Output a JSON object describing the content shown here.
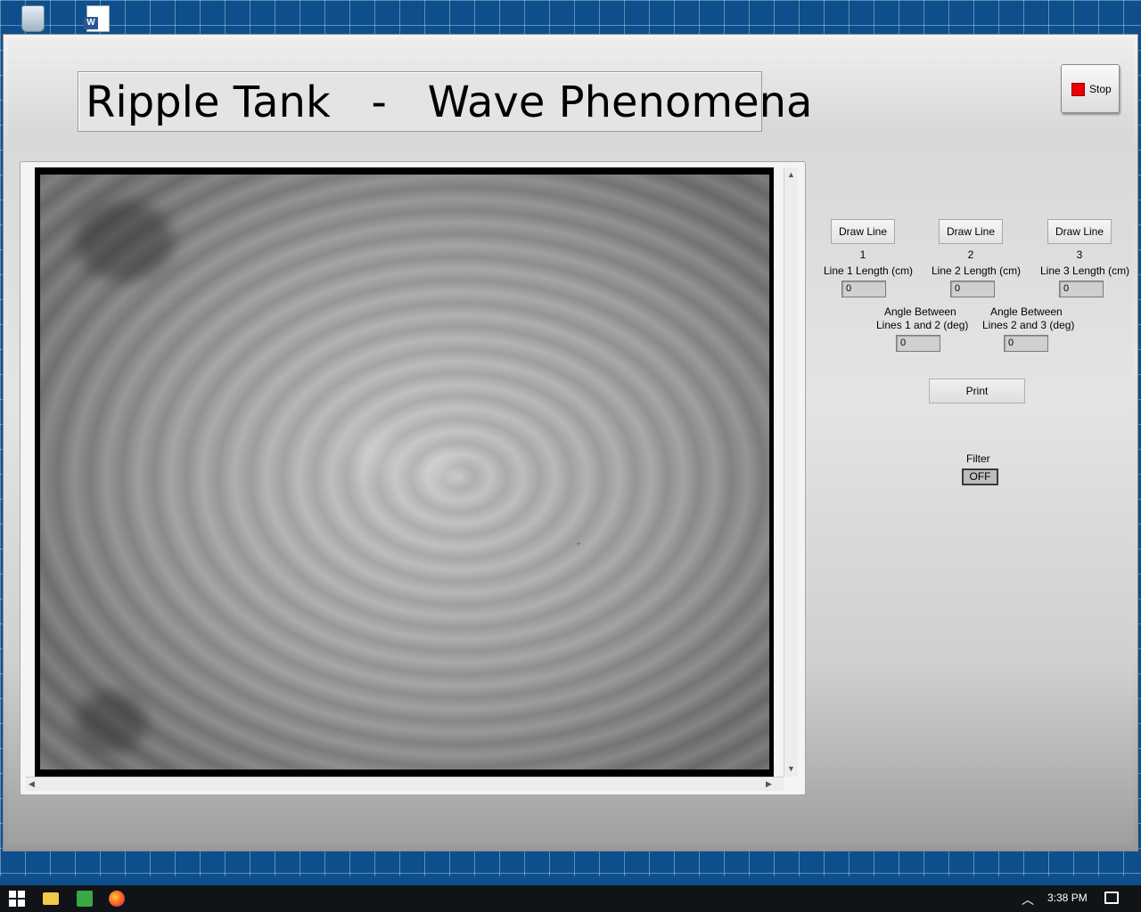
{
  "window": {
    "title": "Ripple Tank   -   Wave Phenomena",
    "stop_label": "Stop"
  },
  "controls": {
    "draw_line_1": "Draw Line 1",
    "draw_line_2": "Draw Line 2",
    "draw_line_3": "Draw Line 3",
    "line1_length_label": "Line 1 Length (cm)",
    "line2_length_label": "Line 2 Length (cm)",
    "line3_length_label": "Line 3 Length (cm)",
    "line1_length_value": "0",
    "line2_length_value": "0",
    "line3_length_value": "0",
    "angle12_label_1": "Angle Between",
    "angle12_label_2": "Lines 1 and 2 (deg)",
    "angle23_label_1": "Angle Between",
    "angle23_label_2": "Lines 2 and 3 (deg)",
    "angle12_value": "0",
    "angle23_value": "0",
    "print_label": "Print",
    "filter_label": "Filter",
    "filter_value": "OFF"
  },
  "taskbar": {
    "clock": "3:38 PM"
  },
  "colors": {
    "stop_indicator": "#ee0000",
    "marker": "#2ba52b",
    "desktop": "#0d4f8c"
  }
}
